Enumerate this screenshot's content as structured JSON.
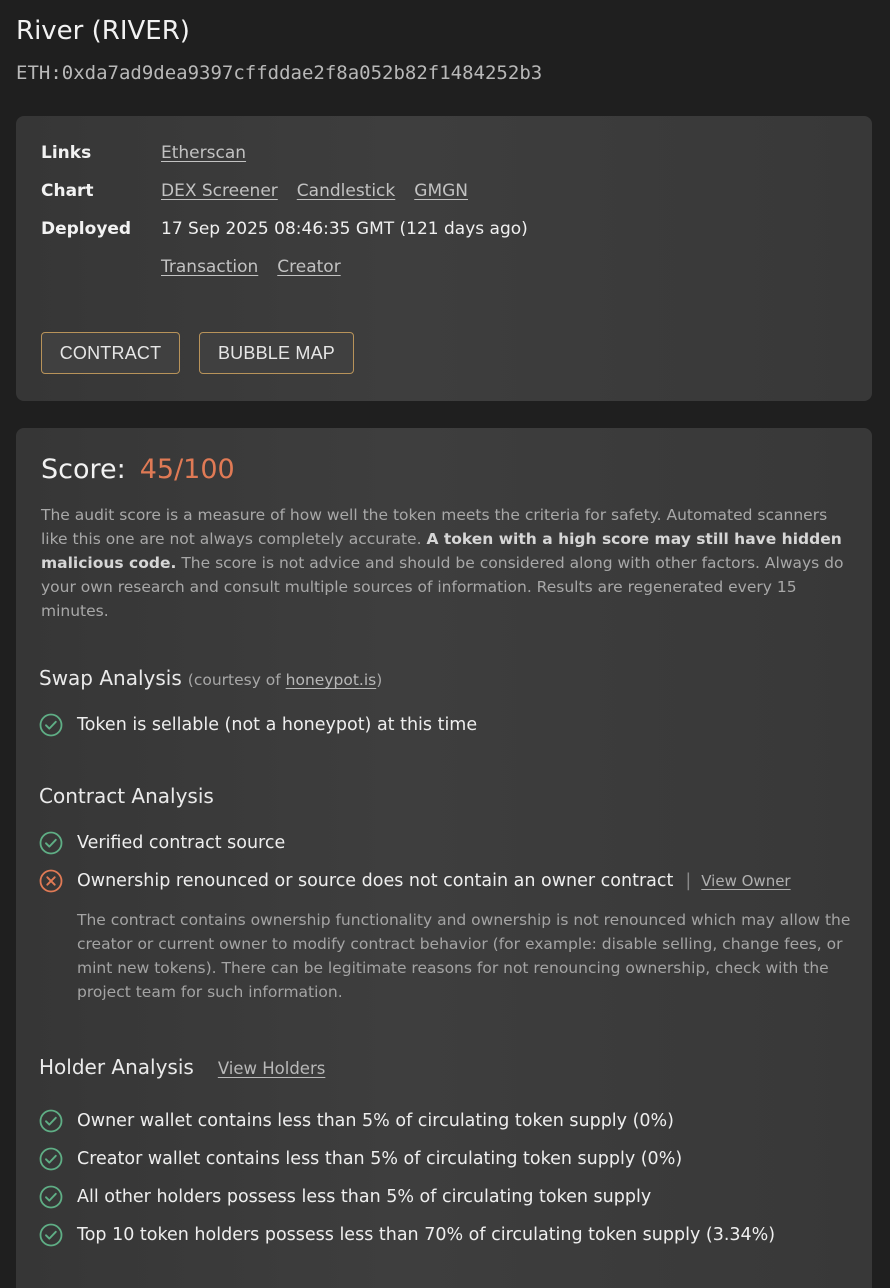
{
  "token": {
    "name": "River (RIVER)",
    "address": "ETH:0xda7ad9dea9397cffddae2f8a052b82f1484252b3"
  },
  "info": {
    "links_label": "Links",
    "links": [
      "Etherscan"
    ],
    "chart_label": "Chart",
    "chart_links": [
      "DEX Screener",
      "Candlestick",
      "GMGN"
    ],
    "deployed_label": "Deployed",
    "deployed_value": "17 Sep 2025 08:46:35 GMT (121 days ago)",
    "deploy_links": [
      "Transaction",
      "Creator"
    ],
    "buttons": {
      "contract": "CONTRACT",
      "bubble_map": "BUBBLE MAP"
    }
  },
  "score": {
    "label": "Score:",
    "value": "45/100",
    "desc_1": "The audit score is a measure of how well the token meets the criteria for safety. Automated scanners like this one are not always completely accurate. ",
    "desc_bold": "A token with a high score may still have hidden malicious code.",
    "desc_2": " The score is not advice and should be considered along with other factors. Always do your own research and consult multiple sources of information. Results are regenerated every 15 minutes."
  },
  "swap": {
    "title": "Swap Analysis",
    "courtesy_prefix": "(courtesy of ",
    "courtesy_link": "honeypot.is",
    "courtesy_suffix": ")",
    "checks": [
      {
        "text": "Token is sellable (not a honeypot) at this time",
        "status": "pass"
      }
    ]
  },
  "contract": {
    "title": "Contract Analysis",
    "checks": [
      {
        "text": "Verified contract source",
        "status": "pass"
      },
      {
        "text": "Ownership renounced or source does not contain an owner contract",
        "status": "fail"
      }
    ],
    "separator": "|",
    "view_owner": "View Owner",
    "warning": "The contract contains ownership functionality and ownership is not renounced which may allow the creator or current owner to modify contract behavior (for example: disable selling, change fees, or mint new tokens). There can be legitimate reasons for not renouncing ownership, check with the project team for such information."
  },
  "holder": {
    "title": "Holder Analysis",
    "view_holders": "View Holders",
    "checks": [
      {
        "text": "Owner wallet contains less than 5% of circulating token supply (0%)",
        "status": "pass"
      },
      {
        "text": "Creator wallet contains less than 5% of circulating token supply (0%)",
        "status": "pass"
      },
      {
        "text": "All other holders possess less than 5% of circulating token supply",
        "status": "pass"
      },
      {
        "text": "Top 10 token holders possess less than 70% of circulating token supply (3.34%)",
        "status": "pass"
      }
    ]
  },
  "colors": {
    "pass": "#5fae85",
    "fail": "#e07a55",
    "score": "#e07a55",
    "button_border": "#b8935a"
  },
  "icons": {
    "pass": "check-circle-icon",
    "fail": "x-circle-icon"
  }
}
